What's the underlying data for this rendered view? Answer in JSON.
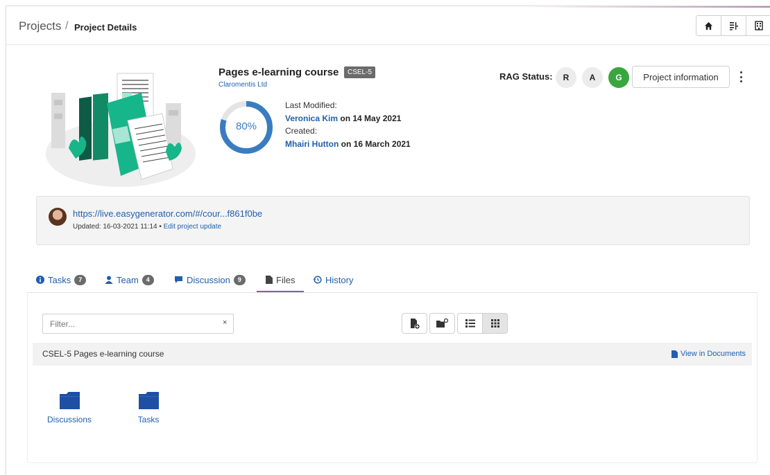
{
  "header": {
    "breadcrumb_root": "Projects",
    "breadcrumb_sep": "/",
    "breadcrumb_current": "Project Details",
    "buttons": [
      "home-icon",
      "tree-list-icon",
      "building-icon"
    ]
  },
  "project": {
    "title": "Pages e-learning course",
    "code": "CSEL-5",
    "company": "Claromentis Ltd",
    "progress_percent": 80,
    "progress_label": "80%",
    "last_modified_label": "Last Modified:",
    "last_modified_by": "Veronica Kim",
    "last_modified_on": " on 14 May 2021",
    "created_label": "Created:",
    "created_by": "Mhairi Hutton",
    "created_on": " on 16 March 2021"
  },
  "rag": {
    "label": "RAG Status:",
    "r": "R",
    "a": "A",
    "g": "G",
    "active": "G",
    "active_color": "#3aa63f"
  },
  "actions": {
    "project_information": "Project information"
  },
  "update": {
    "link": "https://live.easygenerator.com/#/cour...f861f0be",
    "updated_text": "Updated: 16-03-2021 11:14 • ",
    "edit_label": "Edit project update"
  },
  "tabs": [
    {
      "label": "Tasks",
      "count": "7",
      "icon": "info-icon"
    },
    {
      "label": "Team",
      "count": "4",
      "icon": "user-icon"
    },
    {
      "label": "Discussion",
      "count": "9",
      "icon": "comment-icon"
    },
    {
      "label": "Files",
      "icon": "file-icon",
      "active": true
    },
    {
      "label": "History",
      "icon": "history-icon"
    }
  ],
  "files": {
    "filter_placeholder": "Filter...",
    "filter_clear": "×",
    "folder_path": "CSEL-5 Pages e-learning course",
    "view_in_documents": "View in Documents",
    "folders": [
      {
        "label": "Discussions"
      },
      {
        "label": "Tasks"
      }
    ],
    "view_mode": "grid"
  },
  "colors": {
    "link": "#1f5fae",
    "progress": "#3a7cc0",
    "tab_underline": "#8c56b0",
    "folder": "#1f4fa3"
  }
}
